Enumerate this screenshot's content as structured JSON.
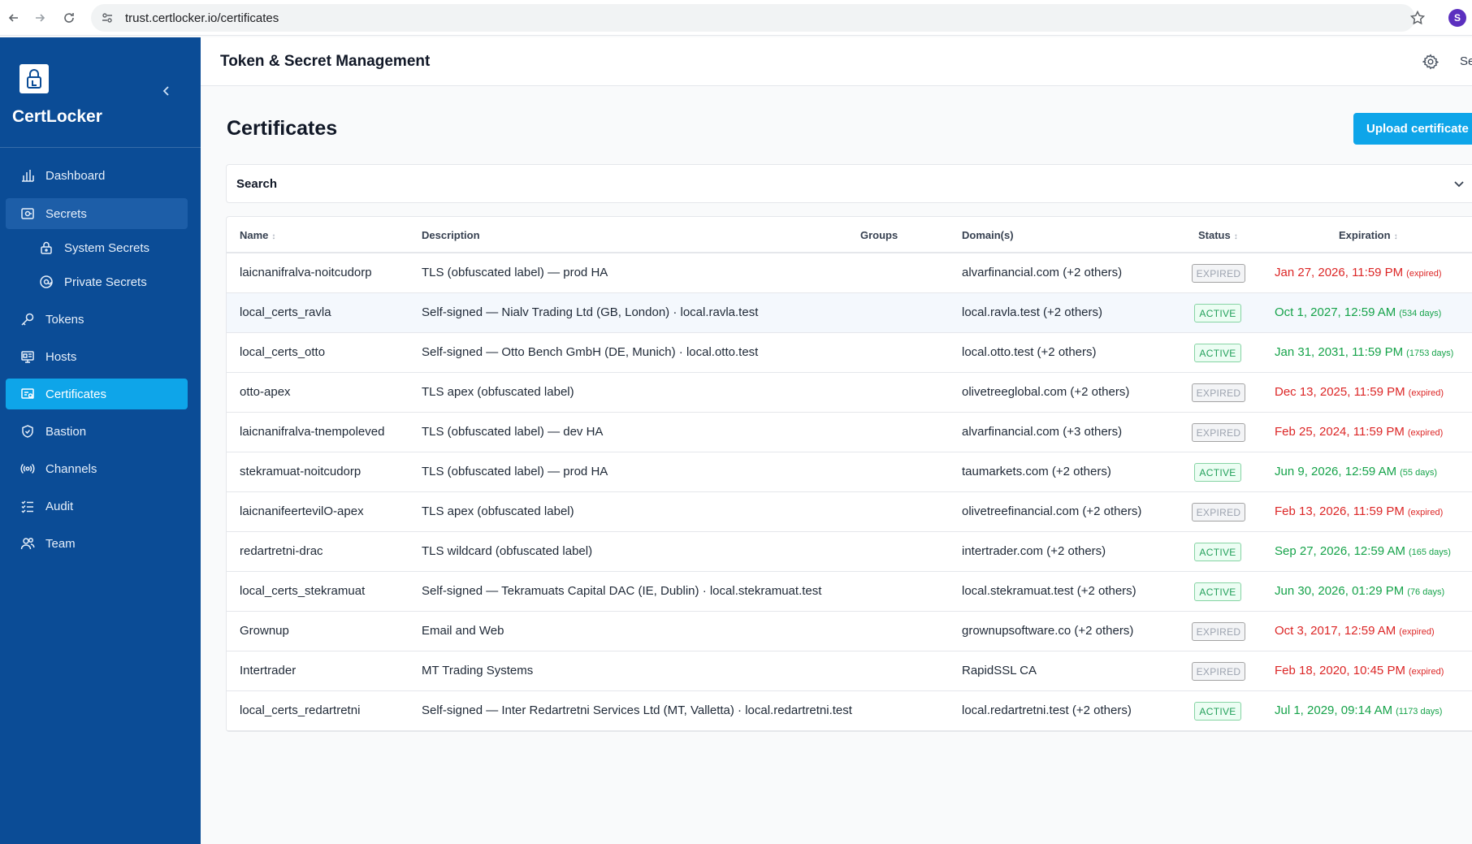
{
  "browser": {
    "url": "trust.certlocker.io/certificates",
    "profile_initial": "S"
  },
  "sidebar": {
    "brand": "CertLocker",
    "items": [
      {
        "label": "Dashboard",
        "icon": "bar-chart-icon"
      },
      {
        "label": "Secrets",
        "icon": "secrets-icon"
      },
      {
        "label": "System Secrets",
        "icon": "lock-icon"
      },
      {
        "label": "Private Secrets",
        "icon": "at-sign-icon"
      },
      {
        "label": "Tokens",
        "icon": "key-icon"
      },
      {
        "label": "Hosts",
        "icon": "hosts-icon"
      },
      {
        "label": "Certificates",
        "icon": "certificate-icon"
      },
      {
        "label": "Bastion",
        "icon": "shield-icon"
      },
      {
        "label": "Channels",
        "icon": "broadcast-icon"
      },
      {
        "label": "Audit",
        "icon": "list-check-icon"
      },
      {
        "label": "Team",
        "icon": "team-icon"
      }
    ]
  },
  "header": {
    "title": "Token & Secret Management",
    "extra": "Se"
  },
  "page": {
    "title": "Certificates",
    "upload_label": "Upload certificate",
    "search_label": "Search"
  },
  "table": {
    "columns": {
      "name": "Name",
      "description": "Description",
      "groups": "Groups",
      "domains": "Domain(s)",
      "status": "Status",
      "expiration": "Expiration"
    },
    "rows": [
      {
        "name": "laicnanifralva-noitcudorp",
        "description": "TLS (obfuscated label) — prod HA",
        "domains": "alvarfinancial.com (+2 others)",
        "status": "EXPIRED",
        "expiration": "Jan 27, 2026, 11:59 PM",
        "note": "(expired)"
      },
      {
        "name": "local_certs_ravla",
        "description": "Self-signed — Nialv Trading Ltd (GB, London) · local.ravla.test",
        "domains": "local.ravla.test (+2 others)",
        "status": "ACTIVE",
        "expiration": "Oct 1, 2027, 12:59 AM",
        "note": "(534 days)"
      },
      {
        "name": "local_certs_otto",
        "description": "Self-signed — Otto Bench GmbH (DE, Munich) · local.otto.test",
        "domains": "local.otto.test (+2 others)",
        "status": "ACTIVE",
        "expiration": "Jan 31, 2031, 11:59 PM",
        "note": "(1753 days)"
      },
      {
        "name": "otto-apex",
        "description": "TLS apex (obfuscated label)",
        "domains": "olivetreeglobal.com (+2 others)",
        "status": "EXPIRED",
        "expiration": "Dec 13, 2025, 11:59 PM",
        "note": "(expired)"
      },
      {
        "name": "laicnanifralva-tnempoleved",
        "description": "TLS (obfuscated label) — dev HA",
        "domains": "alvarfinancial.com (+3 others)",
        "status": "EXPIRED",
        "expiration": "Feb 25, 2024, 11:59 PM",
        "note": "(expired)"
      },
      {
        "name": "stekramuat-noitcudorp",
        "description": "TLS (obfuscated label) — prod HA",
        "domains": "taumarkets.com (+2 others)",
        "status": "ACTIVE",
        "expiration": "Jun 9, 2026, 12:59 AM",
        "note": "(55 days)"
      },
      {
        "name": "laicnanifeertevilO-apex",
        "description": "TLS apex (obfuscated label)",
        "domains": "olivetreefinancial.com (+2 others)",
        "status": "EXPIRED",
        "expiration": "Feb 13, 2026, 11:59 PM",
        "note": "(expired)"
      },
      {
        "name": "redartretni-drac",
        "description": "TLS wildcard (obfuscated label)",
        "domains": "intertrader.com (+2 others)",
        "status": "ACTIVE",
        "expiration": "Sep 27, 2026, 12:59 AM",
        "note": "(165 days)"
      },
      {
        "name": "local_certs_stekramuat",
        "description": "Self-signed — Tekramuats Capital DAC (IE, Dublin) · local.stekramuat.test",
        "domains": "local.stekramuat.test (+2 others)",
        "status": "ACTIVE",
        "expiration": "Jun 30, 2026, 01:29 PM",
        "note": "(76 days)"
      },
      {
        "name": "Grownup",
        "description": "Email and Web",
        "domains": "grownupsoftware.co (+2 others)",
        "status": "EXPIRED",
        "expiration": "Oct 3, 2017, 12:59 AM",
        "note": "(expired)"
      },
      {
        "name": "Intertrader",
        "description": "MT Trading Systems",
        "domains": "RapidSSL CA",
        "status": "EXPIRED",
        "expiration": "Feb 18, 2020, 10:45 PM",
        "note": "(expired)"
      },
      {
        "name": "local_certs_redartretni",
        "description": "Self-signed — Inter Redartretni Services Ltd (MT, Valletta) · local.redartretni.test",
        "domains": "local.redartretni.test (+2 others)",
        "status": "ACTIVE",
        "expiration": "Jul 1, 2029, 09:14 AM",
        "note": "(1173 days)"
      }
    ]
  },
  "colors": {
    "sidebar_bg": "#0b4c96",
    "accent": "#0ea5e9",
    "expired_text": "#dc2626",
    "active_text": "#16a34a"
  }
}
